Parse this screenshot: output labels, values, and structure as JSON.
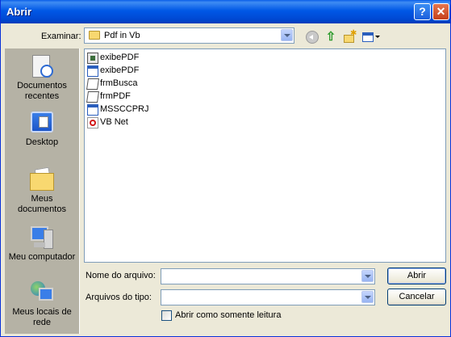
{
  "window": {
    "title": "Abrir"
  },
  "titlebar_buttons": {
    "help": "?",
    "close": "✕"
  },
  "lookin": {
    "label": "Examinar:",
    "value": "Pdf in Vb"
  },
  "toolbar": [
    "back-icon",
    "up-folder-icon",
    "new-folder-icon",
    "views-menu-icon"
  ],
  "places": [
    {
      "label": "Documentos recentes",
      "icon": "recent-documents-icon"
    },
    {
      "label": "Desktop",
      "icon": "desktop-icon"
    },
    {
      "label": "Meus documentos",
      "icon": "my-documents-icon"
    },
    {
      "label": "Meu computador",
      "icon": "my-computer-icon"
    },
    {
      "label": "Meus locais de rede",
      "icon": "network-places-icon"
    }
  ],
  "files": [
    {
      "name": "exibePDF",
      "icon": "vb-project-icon"
    },
    {
      "name": "exibePDF",
      "icon": "vb-form-icon"
    },
    {
      "name": "frmBusca",
      "icon": "vb-module-icon"
    },
    {
      "name": "frmPDF",
      "icon": "vb-module-icon"
    },
    {
      "name": "MSSCCPRJ",
      "icon": "vb-form-icon"
    },
    {
      "name": "VB Net",
      "icon": "pdf-file-icon"
    }
  ],
  "filename": {
    "label": "Nome do arquivo:",
    "value": ""
  },
  "filetype": {
    "label": "Arquivos do tipo:",
    "value": ""
  },
  "readonly": {
    "label": "Abrir como somente leitura",
    "checked": false
  },
  "buttons": {
    "open": "Abrir",
    "cancel": "Cancelar"
  }
}
